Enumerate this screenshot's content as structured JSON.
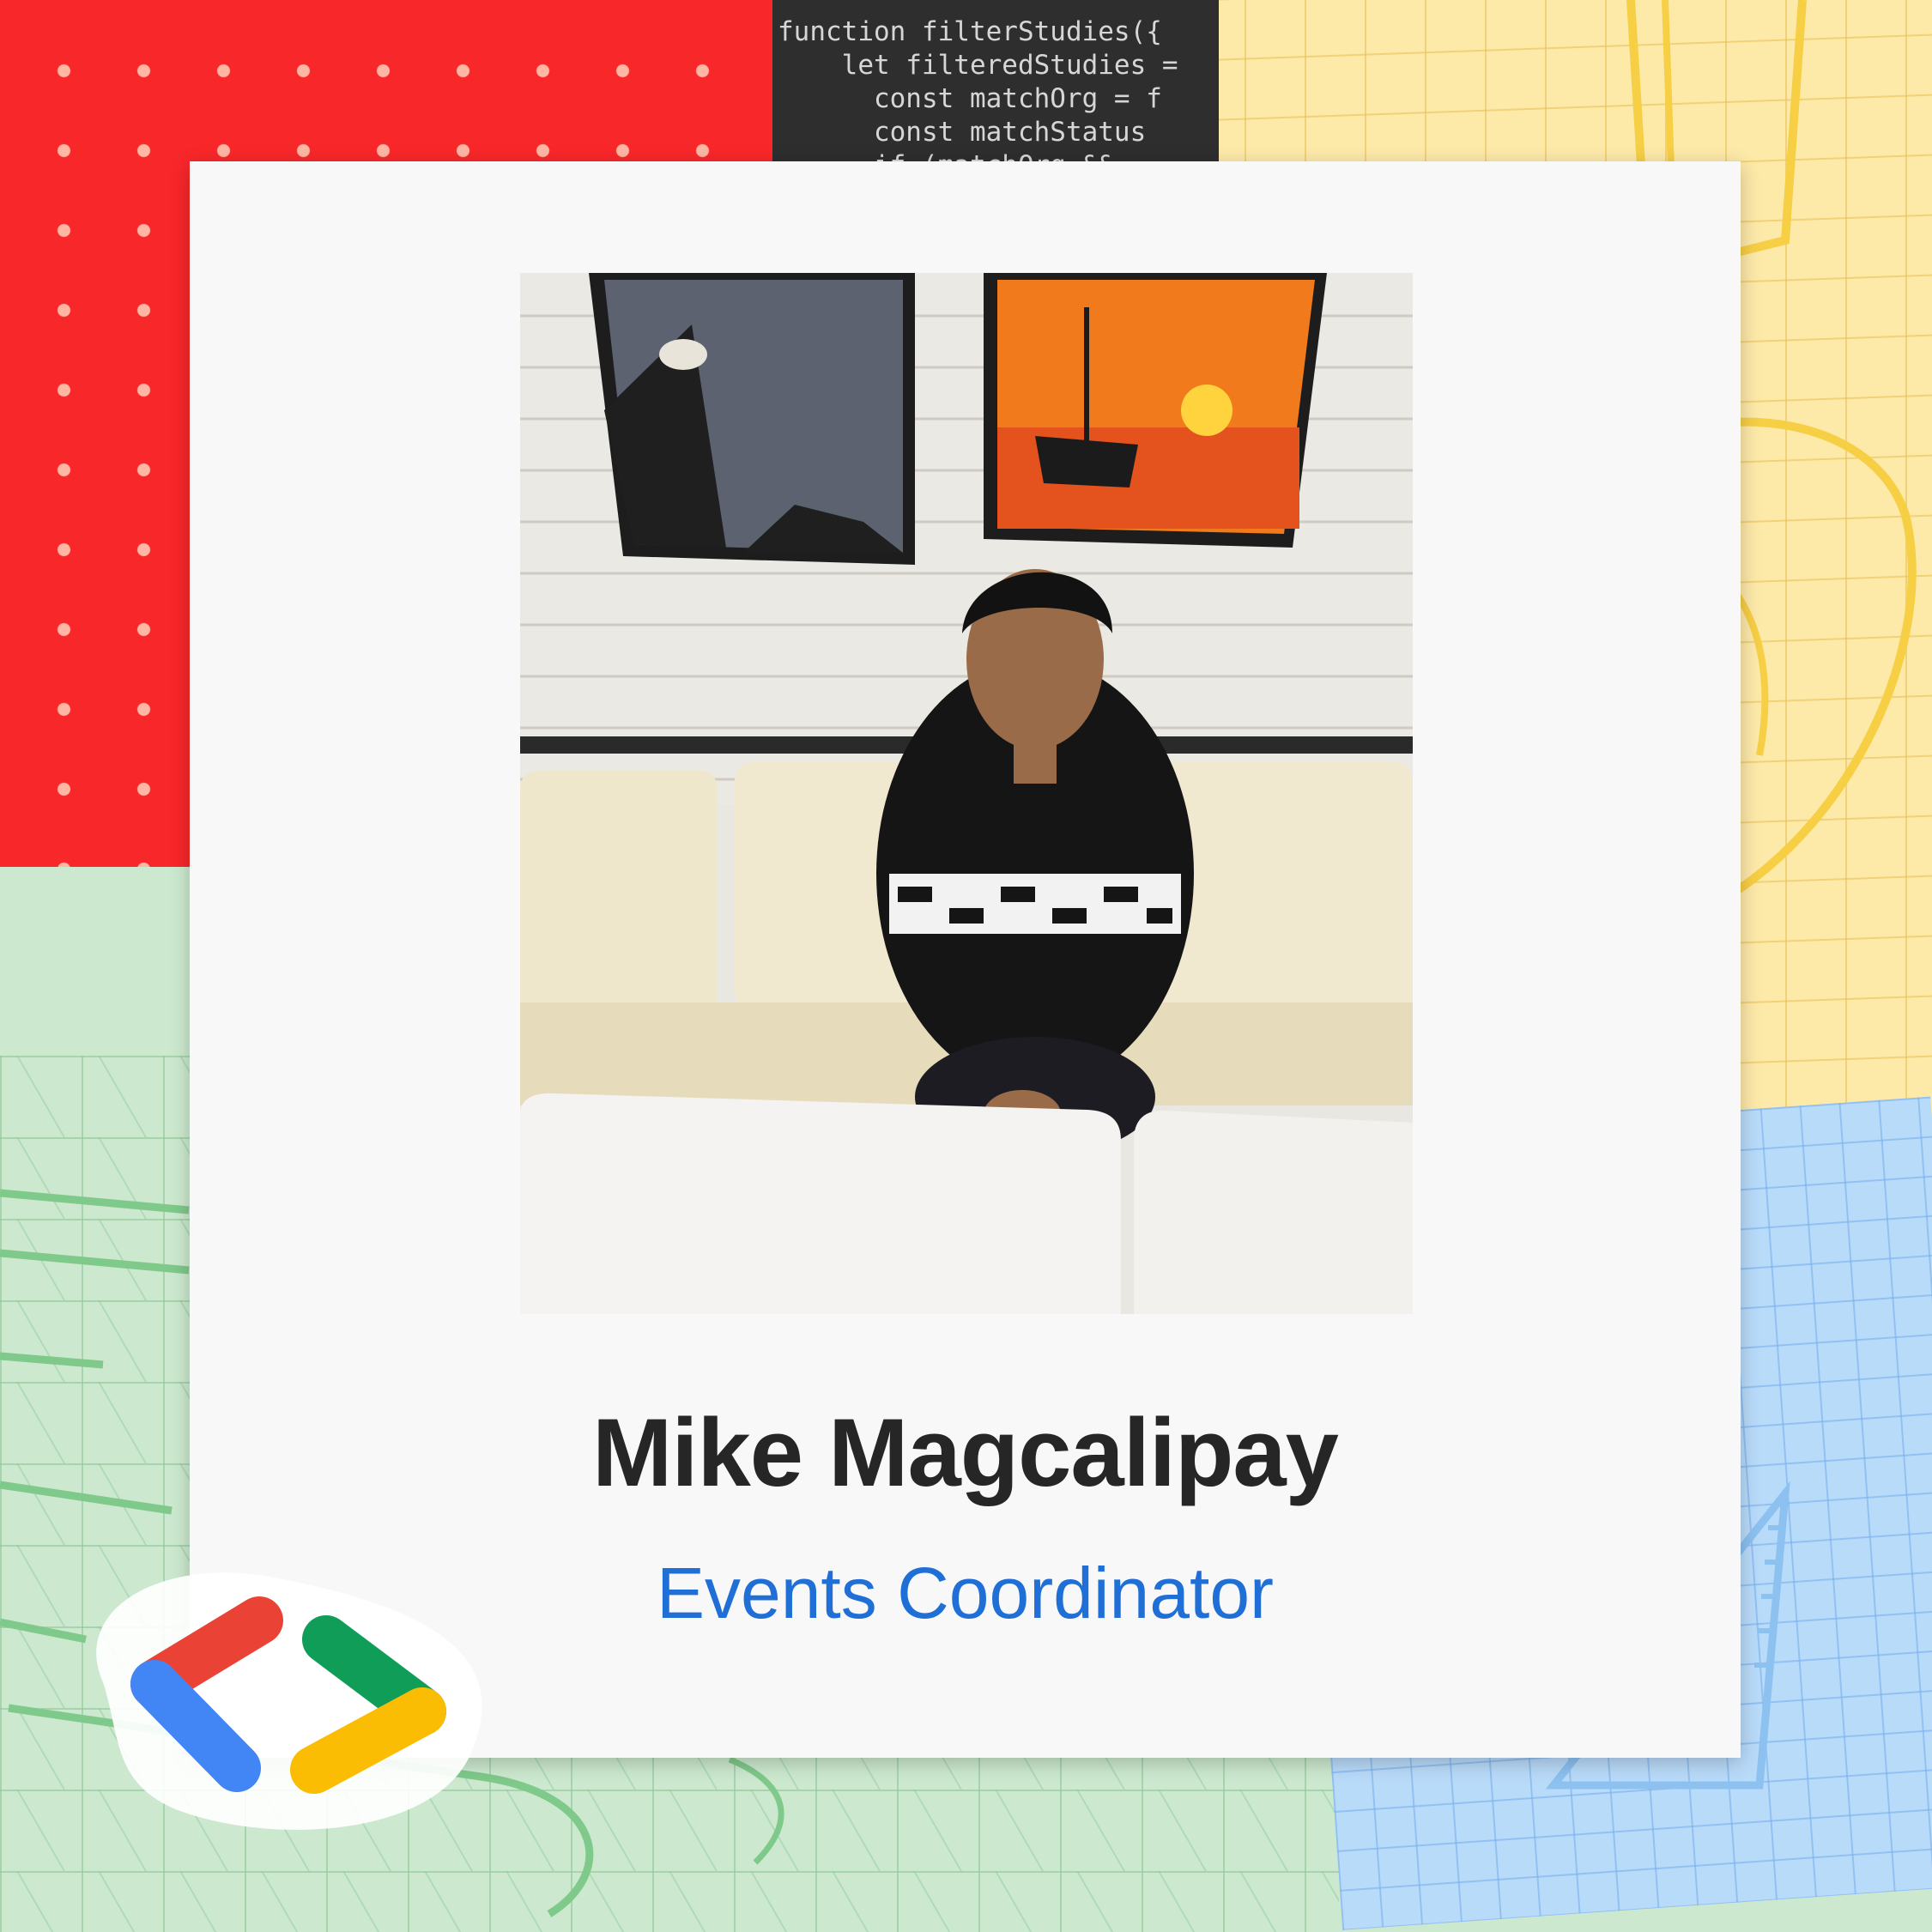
{
  "profile": {
    "name": "Mike Magcalipay",
    "role": "Events Coordinator"
  },
  "code_snippet": "function filterStudies({\n    let filteredStudies =\n      const matchOrg = f\n      const matchStatus\n      if (matchOrg &&",
  "colors": {
    "accent_red": "#f8272a",
    "accent_yellow": "#fde9a8",
    "accent_green": "#cce9cf",
    "accent_blue": "#b9dbfa",
    "role_text": "#1f6fd6",
    "logo_red": "#ea4335",
    "logo_blue": "#4285f4",
    "logo_green": "#0f9d58",
    "logo_yellow": "#fbbc04"
  },
  "icons": {
    "brand_logo": "developer-brackets-logo-icon"
  }
}
